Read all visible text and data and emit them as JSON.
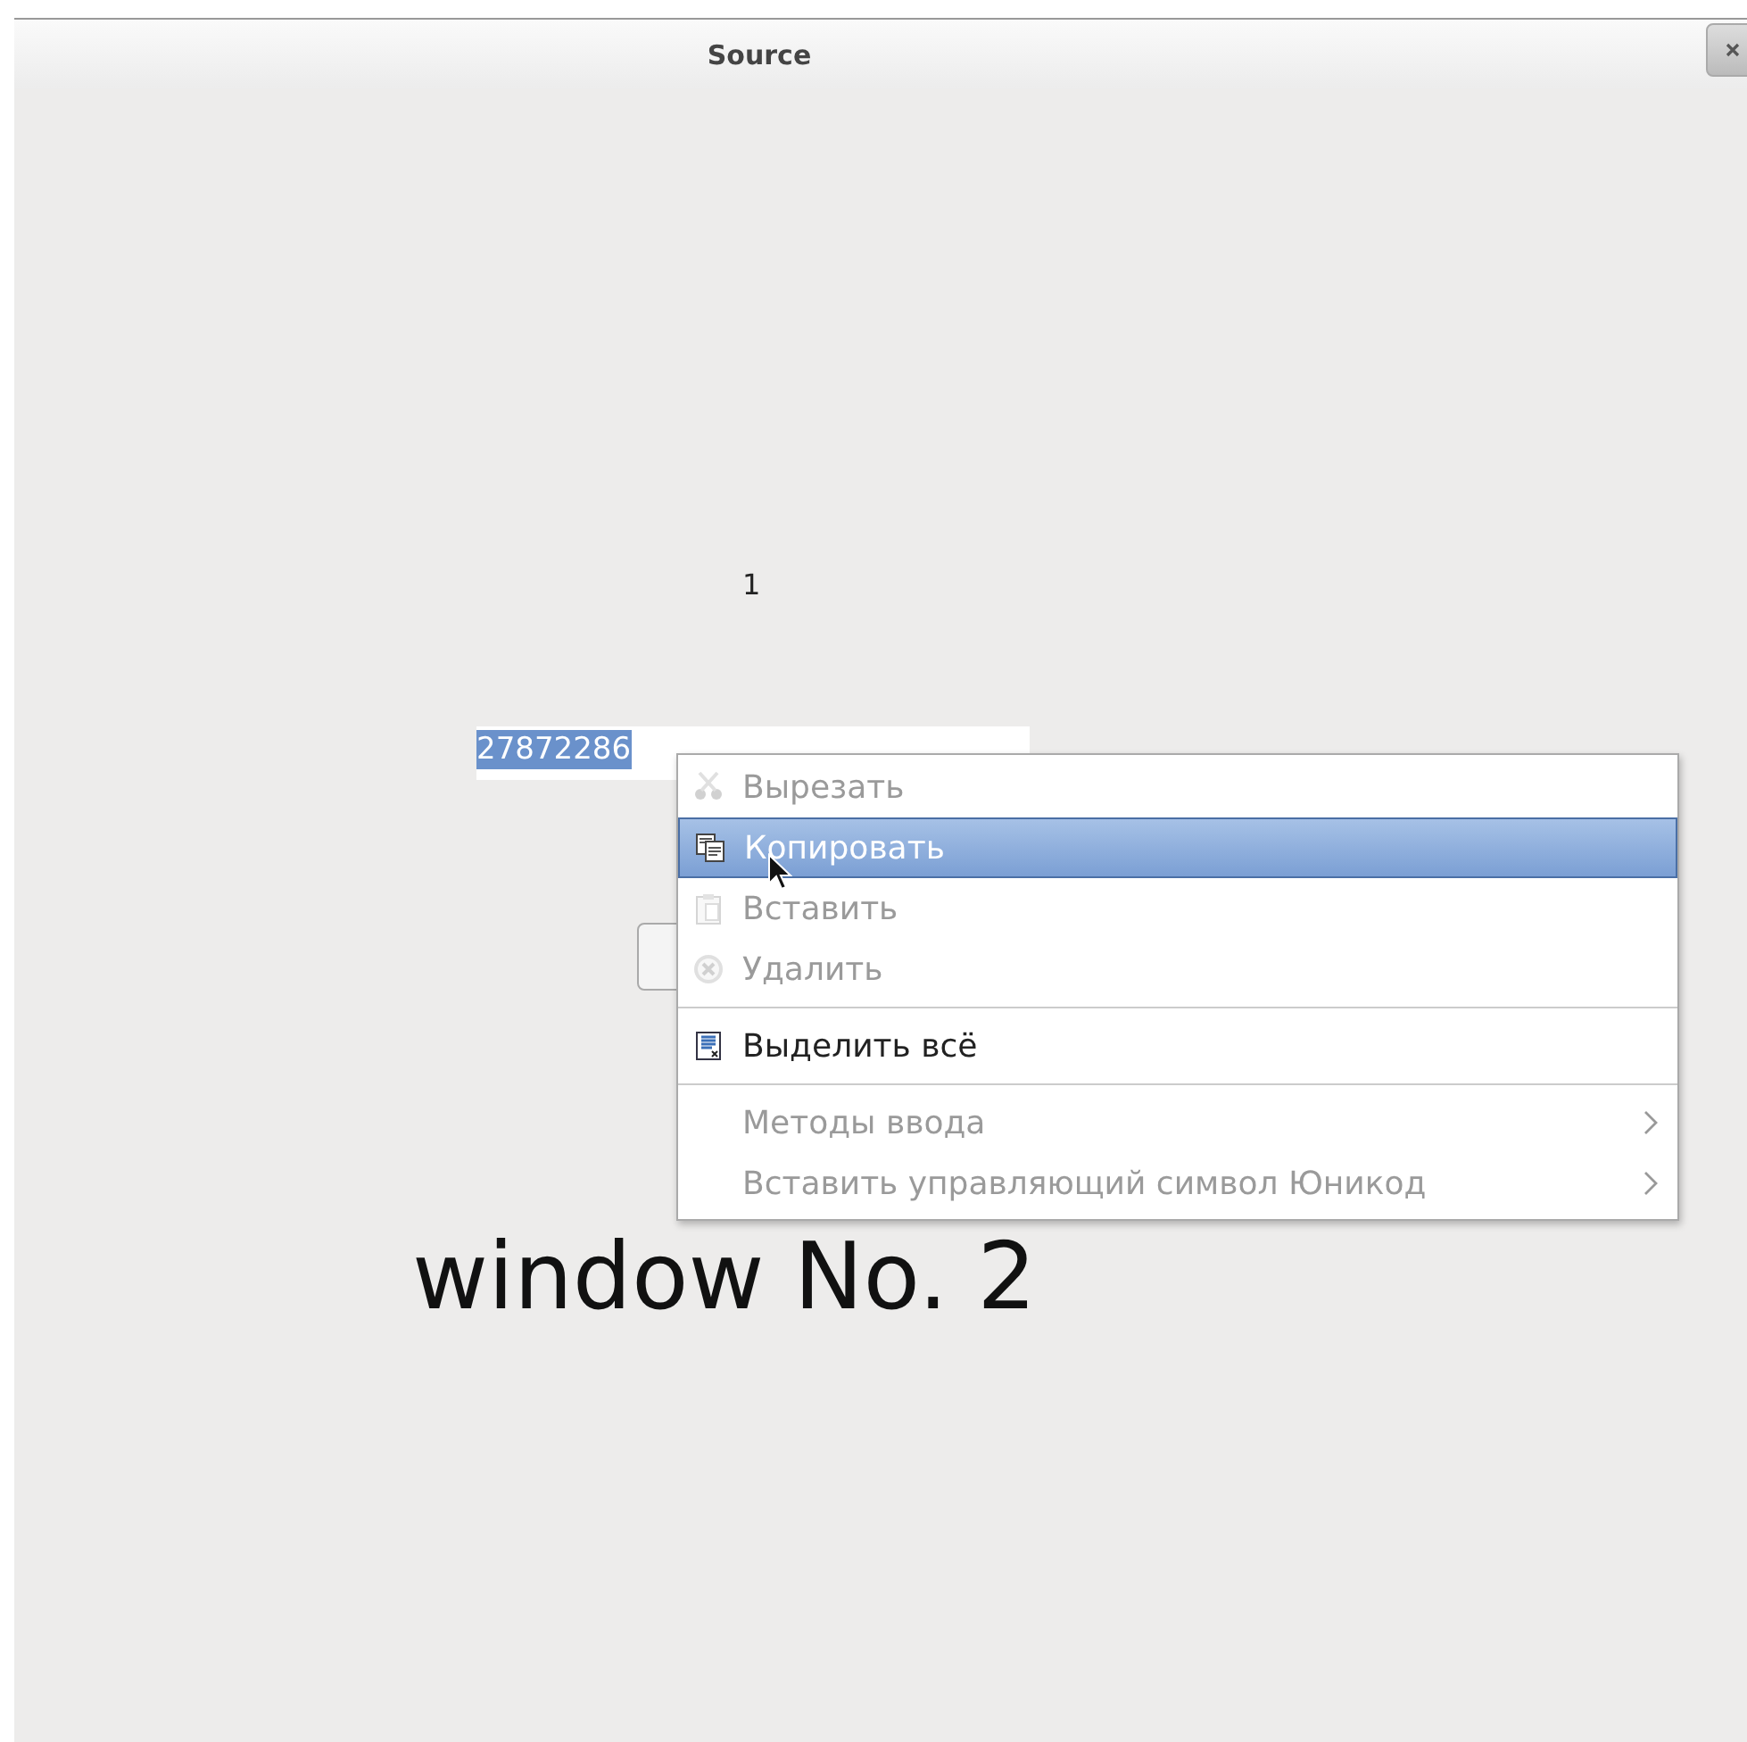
{
  "window": {
    "title": "Source"
  },
  "label": "1",
  "field": {
    "value": "27872286",
    "selected": true
  },
  "heading": "window No. 2",
  "context_menu": {
    "items": [
      {
        "kind": "item",
        "label": "Вырезать",
        "disabled": true,
        "selected": false
      },
      {
        "kind": "item",
        "label": "Копировать",
        "disabled": false,
        "selected": true
      },
      {
        "kind": "item",
        "label": "Вставить",
        "disabled": true,
        "selected": false
      },
      {
        "kind": "item",
        "label": "Удалить",
        "disabled": true,
        "selected": false
      },
      {
        "kind": "separator"
      },
      {
        "kind": "item",
        "label": "Выделить всё",
        "disabled": false,
        "selected": false
      },
      {
        "kind": "separator"
      },
      {
        "kind": "submenu",
        "label": "Методы ввода",
        "disabled": true,
        "selected": false
      },
      {
        "kind": "submenu",
        "label": "Вставить управляющий символ Юникод",
        "disabled": true,
        "selected": false
      }
    ]
  }
}
